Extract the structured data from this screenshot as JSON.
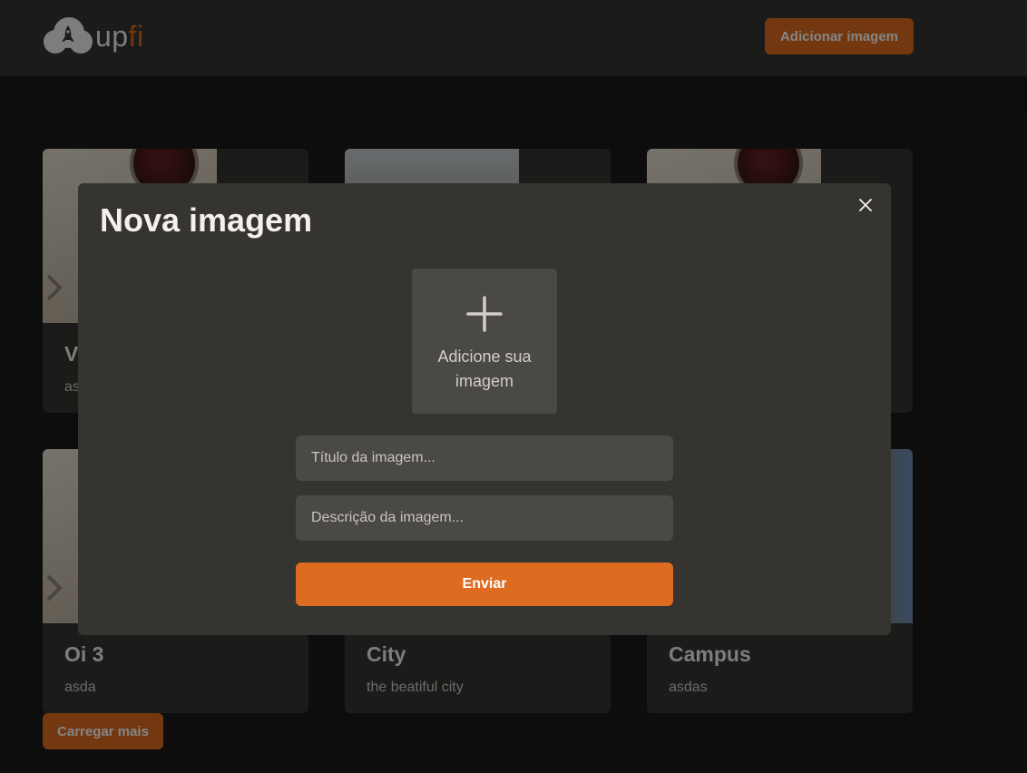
{
  "header": {
    "logo": {
      "up": "up",
      "fi": "fi",
      "icon": "rocket-cloud-icon"
    },
    "add_button_label": "Adicionar imagem"
  },
  "cards": [
    {
      "title": "Vá",
      "description": "asdas",
      "thumbnail": "door-knob-photo"
    },
    {
      "title": "",
      "description": "",
      "thumbnail": "street-photo"
    },
    {
      "title": "",
      "description": "",
      "thumbnail": "door-knob-photo"
    },
    {
      "title": "Oi 3",
      "description": "asda",
      "thumbnail": "door-knob-photo"
    },
    {
      "title": "City",
      "description": "the beatiful city",
      "thumbnail": "city-photo"
    },
    {
      "title": "Campus",
      "description": "asdas",
      "thumbnail": "campus-photo"
    }
  ],
  "load_more_label": "Carregar mais",
  "modal": {
    "title": "Nova imagem",
    "close_icon": "close-icon",
    "dropzone_label": "Adicione sua imagem",
    "dropzone_icon": "plus-icon",
    "title_input": {
      "value": "",
      "placeholder": "Título da imagem..."
    },
    "description_input": {
      "value": "",
      "placeholder": "Descrição da imagem..."
    },
    "submit_label": "Enviar"
  },
  "colors": {
    "accent": "#DD6B20",
    "header_bg": "#353431",
    "page_bg": "#1B1A19",
    "text": "#F4F0EB",
    "input_bg": "#4A4945"
  }
}
